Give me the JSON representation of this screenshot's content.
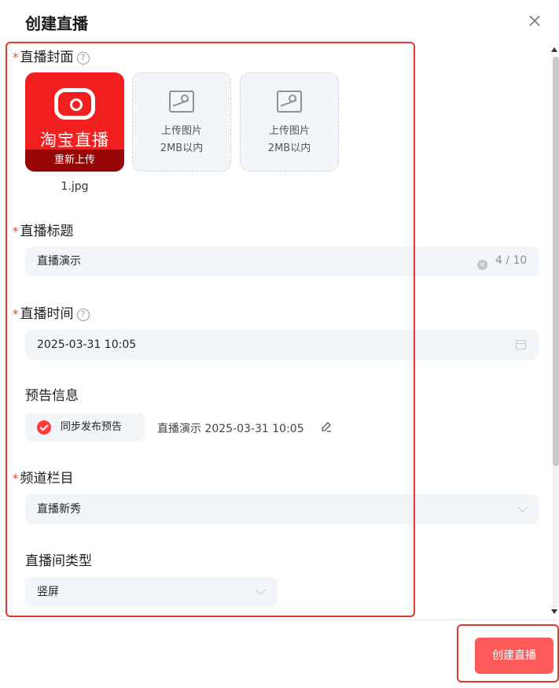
{
  "dialog": {
    "title": "创建直播",
    "close_label": "×"
  },
  "cover": {
    "label": "直播封面",
    "help": "?",
    "image_text": "淘宝直播",
    "reupload_label": "重新上传",
    "filename": "1.jpg",
    "upload_slots": [
      {
        "line1": "上传图片",
        "line2": "2MB以内"
      },
      {
        "line1": "上传图片",
        "line2": "2MB以内"
      }
    ]
  },
  "live_title": {
    "label": "直播标题",
    "value": "直播演示",
    "clear": "×",
    "counter": "4 / 10"
  },
  "live_time": {
    "label": "直播时间",
    "help": "?",
    "value": "2025-03-31 10:05"
  },
  "preview": {
    "label": "预告信息",
    "sync_label": "同步发布预告",
    "notice": "直播演示 2025-03-31 10:05"
  },
  "channel": {
    "label": "频道栏目",
    "value": "直播新秀"
  },
  "room_type": {
    "label": "直播间类型",
    "value": "竖屏"
  },
  "footer": {
    "create_label": "创建直播"
  },
  "colors": {
    "accent": "#ff5a5a",
    "required": "#ff3b30",
    "highlight": "#e03a2f",
    "field_bg": "#f3f6f9"
  }
}
